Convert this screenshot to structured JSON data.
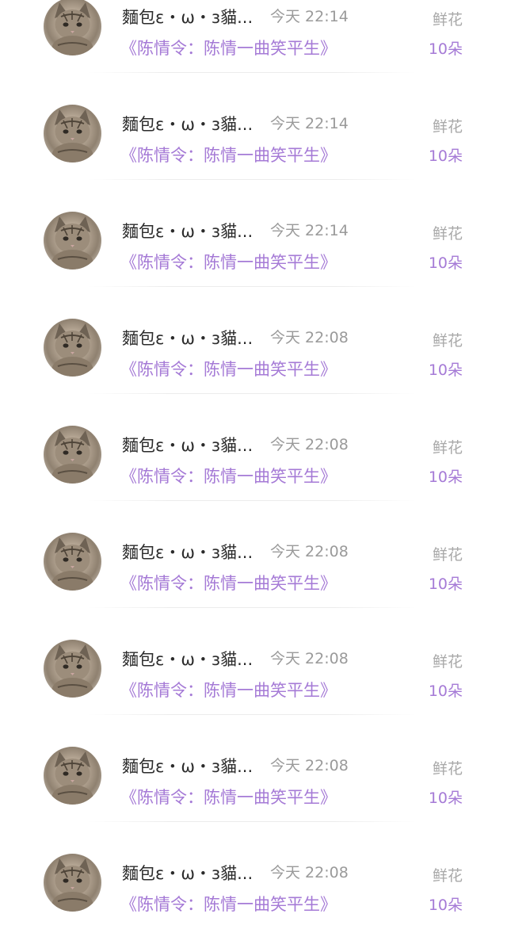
{
  "list": {
    "items": [
      {
        "name": "麵包ε・ω・з貓...",
        "time": "今天 22:14",
        "work": "《陈情令：陈情一曲笑平生》",
        "gift": "鲜花",
        "count": "10朵",
        "avatar": "cat-avatar"
      },
      {
        "name": "麵包ε・ω・з貓...",
        "time": "今天 22:14",
        "work": "《陈情令：陈情一曲笑平生》",
        "gift": "鲜花",
        "count": "10朵",
        "avatar": "cat-avatar"
      },
      {
        "name": "麵包ε・ω・з貓...",
        "time": "今天 22:14",
        "work": "《陈情令：陈情一曲笑平生》",
        "gift": "鲜花",
        "count": "10朵",
        "avatar": "cat-avatar"
      },
      {
        "name": "麵包ε・ω・з貓...",
        "time": "今天 22:08",
        "work": "《陈情令：陈情一曲笑平生》",
        "gift": "鲜花",
        "count": "10朵",
        "avatar": "cat-avatar"
      },
      {
        "name": "麵包ε・ω・з貓...",
        "time": "今天 22:08",
        "work": "《陈情令：陈情一曲笑平生》",
        "gift": "鲜花",
        "count": "10朵",
        "avatar": "cat-avatar"
      },
      {
        "name": "麵包ε・ω・з貓...",
        "time": "今天 22:08",
        "work": "《陈情令：陈情一曲笑平生》",
        "gift": "鲜花",
        "count": "10朵",
        "avatar": "cat-avatar"
      },
      {
        "name": "麵包ε・ω・з貓...",
        "time": "今天 22:08",
        "work": "《陈情令：陈情一曲笑平生》",
        "gift": "鲜花",
        "count": "10朵",
        "avatar": "cat-avatar"
      },
      {
        "name": "麵包ε・ω・з貓...",
        "time": "今天 22:08",
        "work": "《陈情令：陈情一曲笑平生》",
        "gift": "鲜花",
        "count": "10朵",
        "avatar": "cat-avatar"
      },
      {
        "name": "麵包ε・ω・з貓...",
        "time": "今天 22:08",
        "work": "《陈情令：陈情一曲笑平生》",
        "gift": "鲜花",
        "count": "10朵",
        "avatar": "cat-avatar"
      }
    ]
  },
  "colors": {
    "accent": "#a57ad6",
    "name_text": "#2b2b2b",
    "muted_text": "#9a9a9a"
  }
}
